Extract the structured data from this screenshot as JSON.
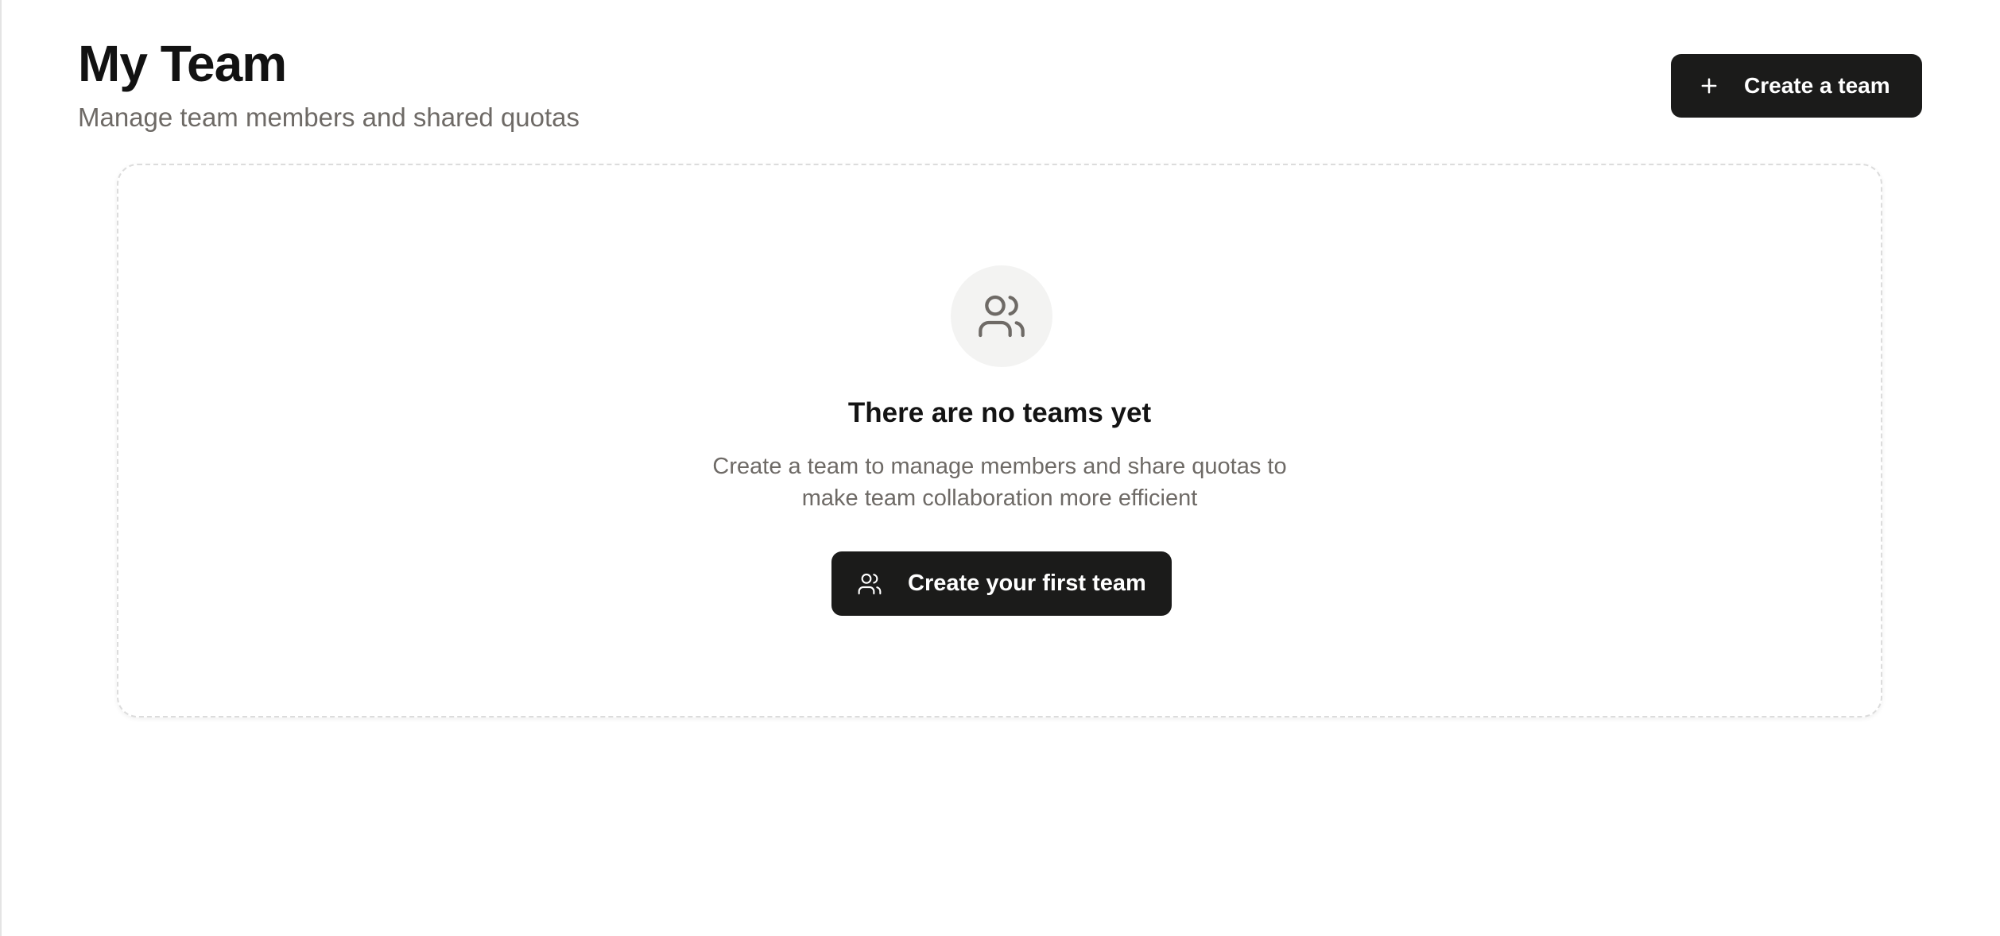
{
  "header": {
    "title": "My Team",
    "subtitle": "Manage team members and shared quotas",
    "create_button_label": "Create a team",
    "create_button_icon": "plus-icon"
  },
  "empty_state": {
    "icon": "users-icon",
    "title": "There are no teams yet",
    "description": "Create a team to manage members and share quotas to make team collaboration more efficient",
    "cta_label": "Create your first team",
    "cta_icon": "users-icon"
  },
  "colors": {
    "button_background": "#1b1b1a",
    "muted_text": "#6e6a66",
    "icon_circle": "#f3f3f2"
  }
}
